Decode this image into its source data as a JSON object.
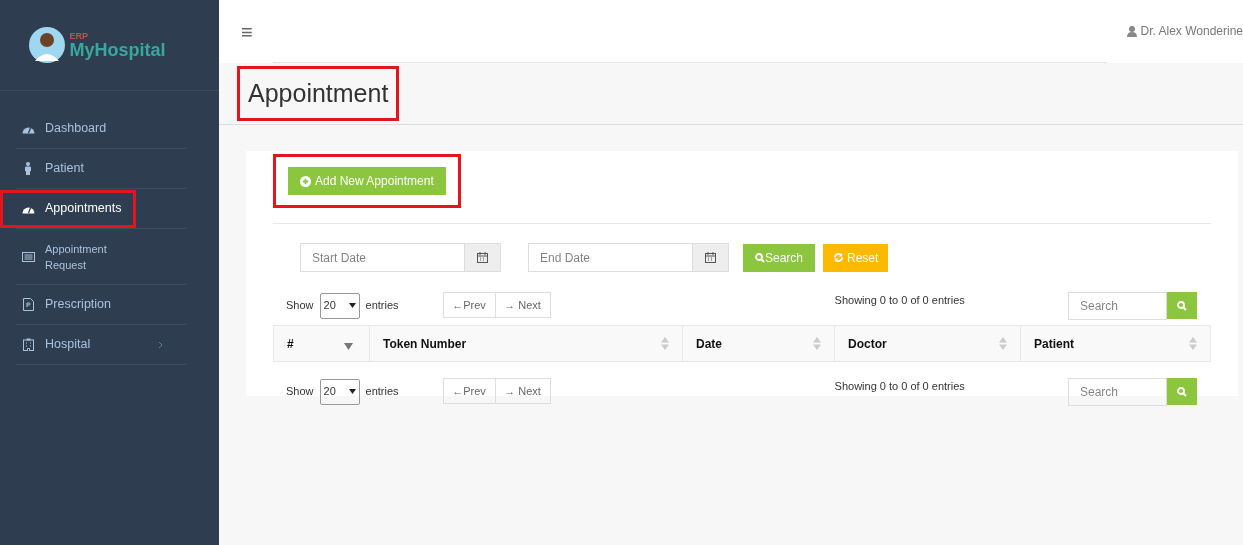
{
  "brand": {
    "tag": "ERP",
    "name": "MyHospital"
  },
  "sidebar": {
    "items": [
      {
        "label": "Dashboard",
        "kind": "gauge",
        "selected": false,
        "highlighted": false,
        "expandable": false
      },
      {
        "label": "Patient",
        "kind": "person",
        "selected": false,
        "highlighted": false,
        "expandable": false
      },
      {
        "label": "Appointments",
        "kind": "gauge",
        "selected": true,
        "highlighted": true,
        "expandable": false
      },
      {
        "label": "Appointment Request",
        "kind": "card",
        "selected": false,
        "highlighted": false,
        "expandable": false
      },
      {
        "label": "Prescription",
        "kind": "doc",
        "selected": false,
        "highlighted": false,
        "expandable": false
      },
      {
        "label": "Hospital",
        "kind": "building",
        "selected": false,
        "highlighted": false,
        "expandable": true
      }
    ]
  },
  "topbar": {
    "menu_glyph": "≡",
    "user": "Dr. Alex Wonderine"
  },
  "page_title": {
    "text": "Appointment",
    "highlighted": true
  },
  "add_button": {
    "label": "Add New Appointment",
    "highlighted": true
  },
  "filters": {
    "start_placeholder": "Start Date",
    "end_placeholder": "End Date",
    "search_button": "Search",
    "reset_button": "Reset"
  },
  "table_controls": [
    {
      "show": "Show",
      "page_size": "20",
      "entries": "entries",
      "prev": "←Prev",
      "next": "→ Next",
      "info": "Showing 0 to 0 of 0 entries",
      "search_placeholder": "Search"
    },
    {
      "show": "Show",
      "page_size": "20",
      "entries": "entries",
      "prev": "←Prev",
      "next": "→ Next",
      "info": "Showing 0 to 0 of 0 entries",
      "search_placeholder": "Search"
    }
  ],
  "table": {
    "columns": [
      {
        "label": "#",
        "sorted": true
      },
      {
        "label": "Token Number",
        "sorted": false
      },
      {
        "label": "Date",
        "sorted": false
      },
      {
        "label": "Doctor",
        "sorted": false
      },
      {
        "label": "Patient",
        "sorted": false
      }
    ]
  }
}
